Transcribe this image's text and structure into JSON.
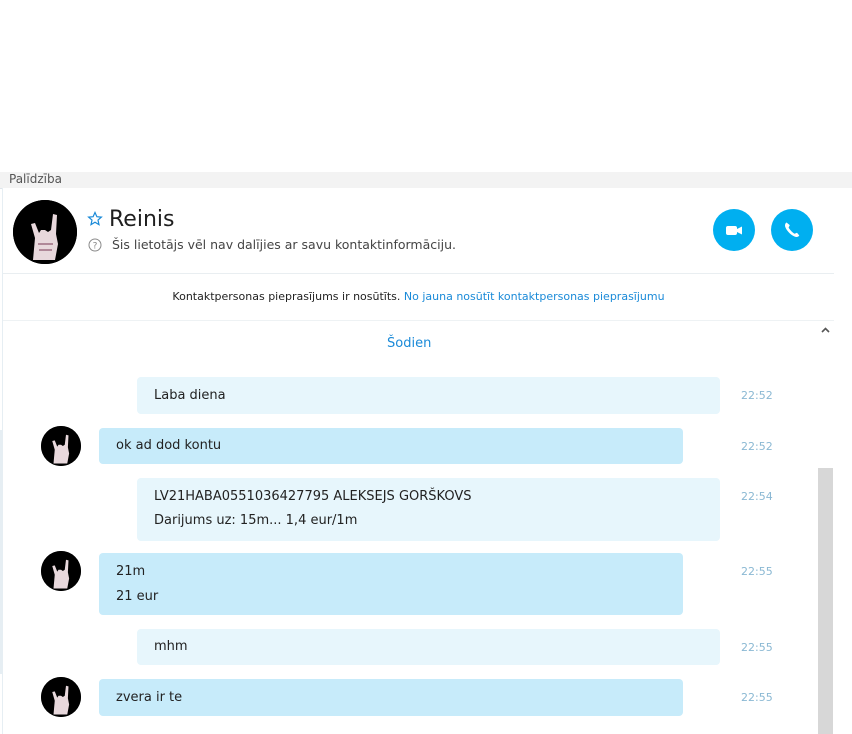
{
  "menu": {
    "help": "Palīdzība"
  },
  "contact": {
    "name": "Reinis",
    "status": "Šis lietotājs vēl nav dalījies ar savu kontaktinformāciju."
  },
  "notice": {
    "text": "Kontaktpersonas pieprasījums ir nosūtīts.",
    "link": "No jauna nosūtīt kontaktpersonas pieprasījumu"
  },
  "date_separator": "Šodien",
  "messages": [
    {
      "lines": [
        "Laba diena"
      ],
      "time": "22:52"
    },
    {
      "lines": [
        "ok ad dod kontu"
      ],
      "time": "22:52"
    },
    {
      "lines": [
        "LV21HABA0551036427795 ALEKSEJS GORŠKOVS",
        "Darijums uz: 15m... 1,4 eur/1m"
      ],
      "time": "22:54"
    },
    {
      "lines": [
        "21m",
        "21 eur"
      ],
      "time": "22:55"
    },
    {
      "lines": [
        "mhm"
      ],
      "time": "22:55"
    },
    {
      "lines": [
        "zvera ir te"
      ],
      "time": "22:55"
    }
  ],
  "icons": {
    "favorite": "star-outline-icon",
    "info": "question-circle-icon",
    "video": "video-camera-icon",
    "call": "phone-icon",
    "scroll_up": "chevron-up-icon"
  },
  "colors": {
    "accent": "#00aff0",
    "link": "#1a8ad8",
    "bubble_outgoing": "#e7f6fc",
    "bubble_incoming": "#c7ebfa",
    "timestamp": "#8ab8d3"
  }
}
